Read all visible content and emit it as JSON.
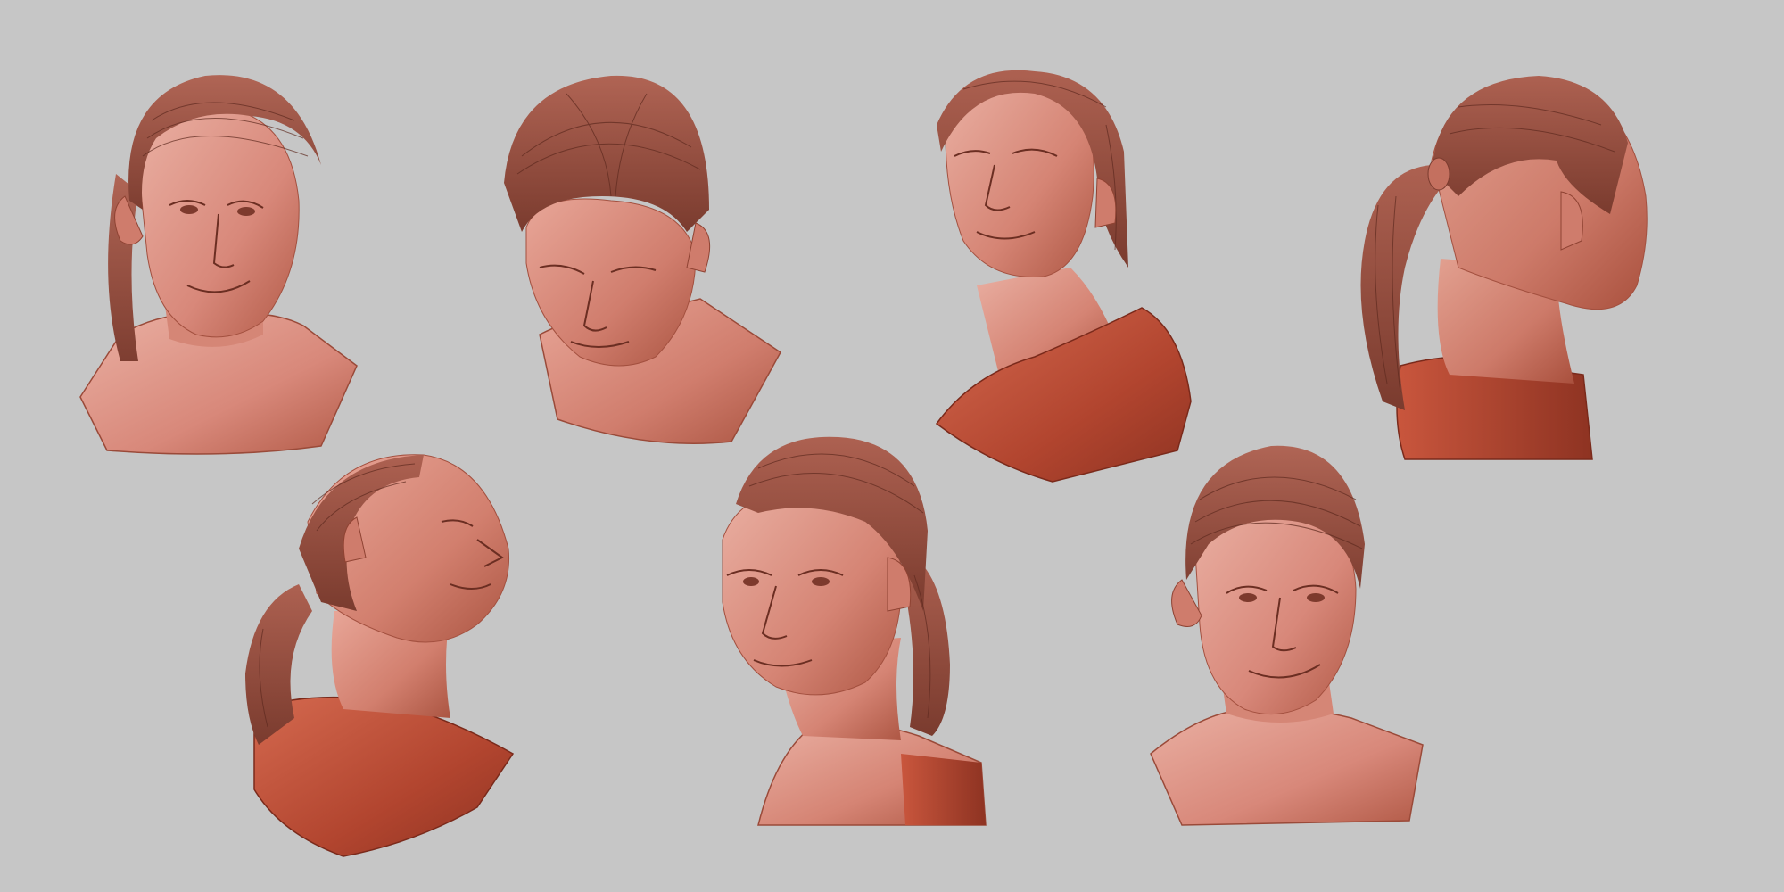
{
  "canvas": {
    "background": "#c6c6c6"
  },
  "palette": {
    "skin_light": "#e8a79a",
    "skin_mid": "#d27f6e",
    "skin_dark": "#a9503d",
    "cut_light": "#d46a50",
    "cut_dark": "#8e3322",
    "hair": "#9a5445",
    "hair_strand": "#5e2a1f",
    "feature": "#6b2e22"
  },
  "busts": [
    {
      "name": "bust-front-three-quarter-left",
      "view": "front-left",
      "tilt": -4,
      "hair": "ponytail-hidden",
      "base": "bust"
    },
    {
      "name": "bust-looking-down",
      "view": "down",
      "tilt": 0,
      "hair": "swept-back",
      "base": "bust"
    },
    {
      "name": "bust-looking-up",
      "view": "up-left",
      "tilt": 0,
      "hair": "swept-back",
      "base": "cut-block"
    },
    {
      "name": "bust-rear-right-profile",
      "view": "back-right",
      "tilt": 0,
      "hair": "ponytail",
      "base": "cut-block"
    },
    {
      "name": "bust-low-angle-right-profile",
      "view": "up-right",
      "tilt": 0,
      "hair": "ponytail",
      "base": "cut-block"
    },
    {
      "name": "bust-three-quarter-left-with-ponytail",
      "view": "three-quarter-left",
      "tilt": 0,
      "hair": "ponytail-side",
      "base": "bust"
    },
    {
      "name": "bust-front-smiling",
      "view": "front",
      "tilt": 0,
      "hair": "ponytail-hidden",
      "base": "bust"
    }
  ]
}
